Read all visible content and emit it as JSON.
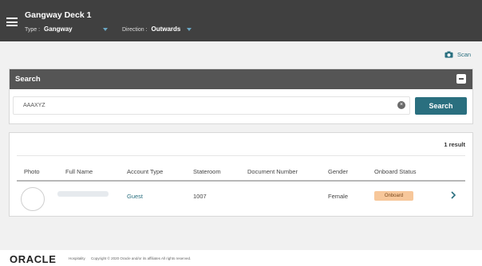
{
  "header": {
    "title": "Gangway Deck 1",
    "type_label": "Type :",
    "type_value": "Gangway",
    "direction_label": "Direction :",
    "direction_value": "Outwards"
  },
  "scan": {
    "label": "Scan"
  },
  "search": {
    "heading": "Search",
    "input_value": "AAAXYZ",
    "button_label": "Search"
  },
  "results": {
    "count_text": "1 result",
    "columns": [
      "Photo",
      "Full Name",
      "Account Type",
      "Stateroom",
      "Document Number",
      "Gender",
      "Onboard Status"
    ],
    "rows": [
      {
        "account_type": "Guest",
        "stateroom": "1007",
        "document_number": "",
        "gender": "Female",
        "onboard_status": "Onboard"
      }
    ]
  },
  "footer": {
    "logo": "ORACLE",
    "sub": "Hospitality",
    "copyright": "Copyright © 2020 Oracle and/or its affiliates All rights reserved."
  },
  "colors": {
    "header": "#404040",
    "accent": "#2a6f7f",
    "badge": "#f7c79a"
  }
}
